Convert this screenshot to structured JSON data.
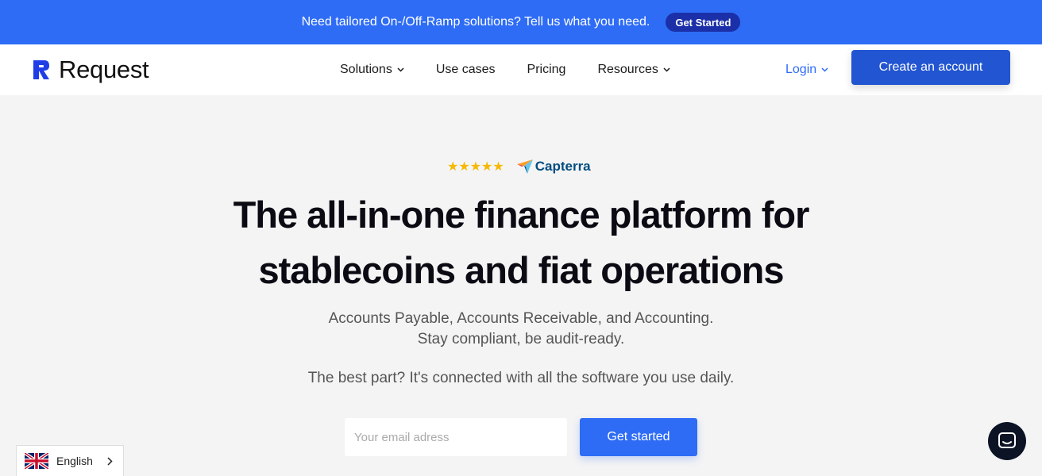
{
  "announcement": {
    "text": "Need tailored On-/Off-Ramp solutions? Tell us what you need.",
    "button_label": "Get Started"
  },
  "header": {
    "logo_text": "Request",
    "nav": {
      "solutions": "Solutions",
      "use_cases": "Use cases",
      "pricing": "Pricing",
      "resources": "Resources"
    },
    "login_label": "Login",
    "create_account_label": "Create an account"
  },
  "hero": {
    "rating_stars": "★★★★★",
    "review_brand": "Capterra",
    "headline_line1": "The all-in-one finance platform for",
    "headline_line2": "stablecoins and fiat operations",
    "sub_line1": "Accounts Payable, Accounts Receivable, and Accounting.",
    "sub_line2": "Stay compliant, be audit-ready.",
    "sub_line3": "The best part? It's connected with all the software you use daily.",
    "email_placeholder": "Your email adress",
    "cta_label": "Get started"
  },
  "language": {
    "selected": "English"
  },
  "colors": {
    "brand_blue": "#2e6cf6",
    "button_dark_blue": "#2255d1",
    "announce_pill": "#1a2fa8",
    "star_yellow": "#f6b800"
  }
}
